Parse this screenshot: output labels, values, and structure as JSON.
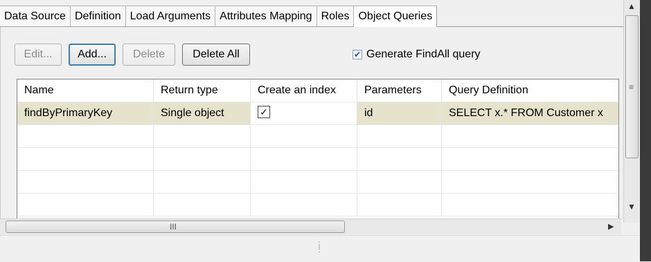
{
  "tabs": [
    {
      "label": "Data Source"
    },
    {
      "label": "Definition"
    },
    {
      "label": "Load Arguments"
    },
    {
      "label": "Attributes Mapping"
    },
    {
      "label": "Roles"
    },
    {
      "label": "Object Queries",
      "active": true
    }
  ],
  "buttons": {
    "edit": "Edit...",
    "add": "Add...",
    "delete": "Delete",
    "delete_all": "Delete All"
  },
  "generate_findall": {
    "label": "Generate FindAll query",
    "checked": true
  },
  "table": {
    "columns": [
      "Name",
      "Return type",
      "Create an index",
      "Parameters",
      "Query Definition"
    ],
    "rows": [
      {
        "name": "findByPrimaryKey",
        "return_type": "Single object",
        "create_index": true,
        "parameters": "id",
        "query": "SELECT x.* FROM Customer x"
      }
    ]
  },
  "scroll_grip": "III",
  "colors": {
    "selected_row": "#e5e3cb",
    "focus_border": "#3c7fb1"
  }
}
